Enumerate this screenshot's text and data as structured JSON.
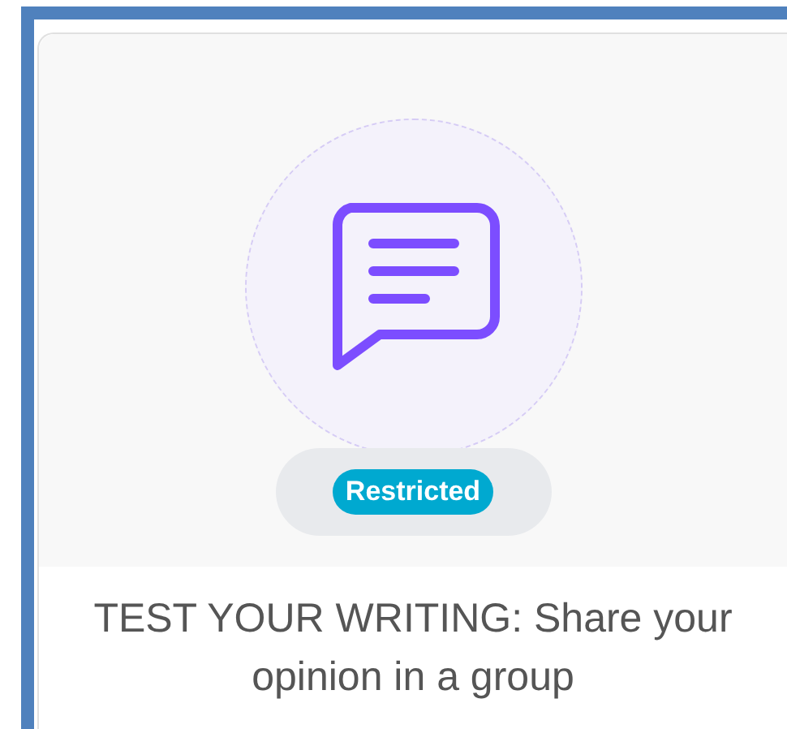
{
  "card": {
    "badge": "Restricted",
    "title": "TEST YOUR WRITING: Share your opinion in a group"
  }
}
